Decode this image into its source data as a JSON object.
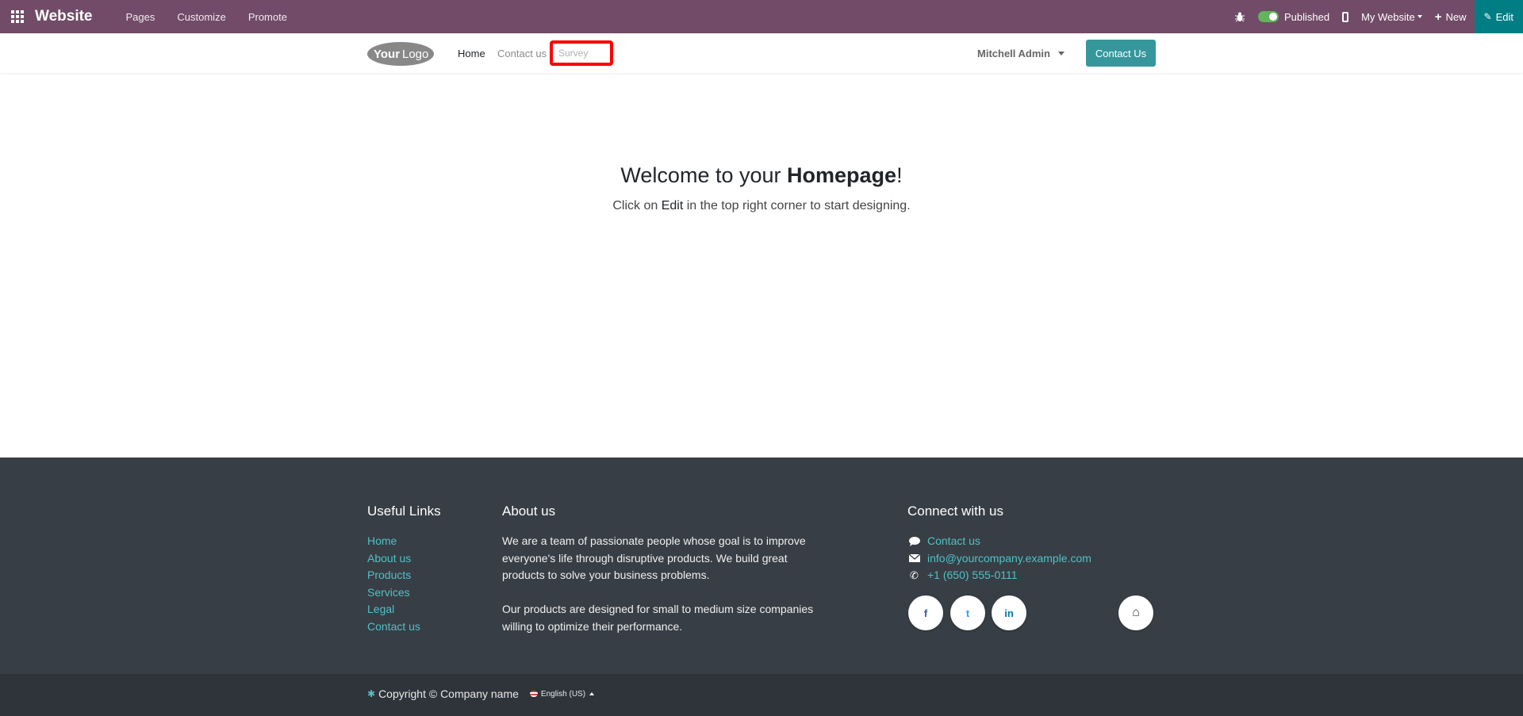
{
  "topbar": {
    "brand": "Website",
    "menu": [
      "Pages",
      "Customize",
      "Promote"
    ],
    "published_label": "Published",
    "website_selector": "My Website",
    "new_label": "New",
    "edit_label": "Edit",
    "background_color": "#714b67",
    "edit_color": "#017e84"
  },
  "header": {
    "logo_text": "YourLogo",
    "nav": {
      "home": "Home",
      "contact": "Contact us",
      "survey_placeholder": "Survey"
    },
    "user": "Mitchell Admin",
    "contact_button": "Contact Us",
    "accent_color": "#35979c"
  },
  "hero": {
    "title_prefix": "Welcome to your ",
    "title_bold": "Homepage",
    "title_suffix": "!",
    "sub_prefix": "Click on ",
    "sub_em": "Edit",
    "sub_suffix": " in the top right corner to start designing."
  },
  "footer": {
    "useful_links_title": "Useful Links",
    "useful_links": [
      "Home",
      "About us",
      "Products",
      "Services",
      "Legal",
      "Contact us"
    ],
    "about_title": "About us",
    "about_p1": "We are a team of passionate people whose goal is to improve everyone's life through disruptive products. We build great products to solve your business problems.",
    "about_p2": "Our products are designed for small to medium size companies willing to optimize their performance.",
    "connect_title": "Connect with us",
    "connect": {
      "contact": "Contact us",
      "email": "info@yourcompany.example.com",
      "phone": "+1 (650) 555-0111"
    },
    "social": {
      "facebook": "f",
      "twitter": "t",
      "linkedin": "in",
      "home": "⌂"
    },
    "copyright": "Copyright © Company name",
    "language": "English (US)",
    "background_color": "#383e45",
    "link_color": "#4fc1c7"
  }
}
